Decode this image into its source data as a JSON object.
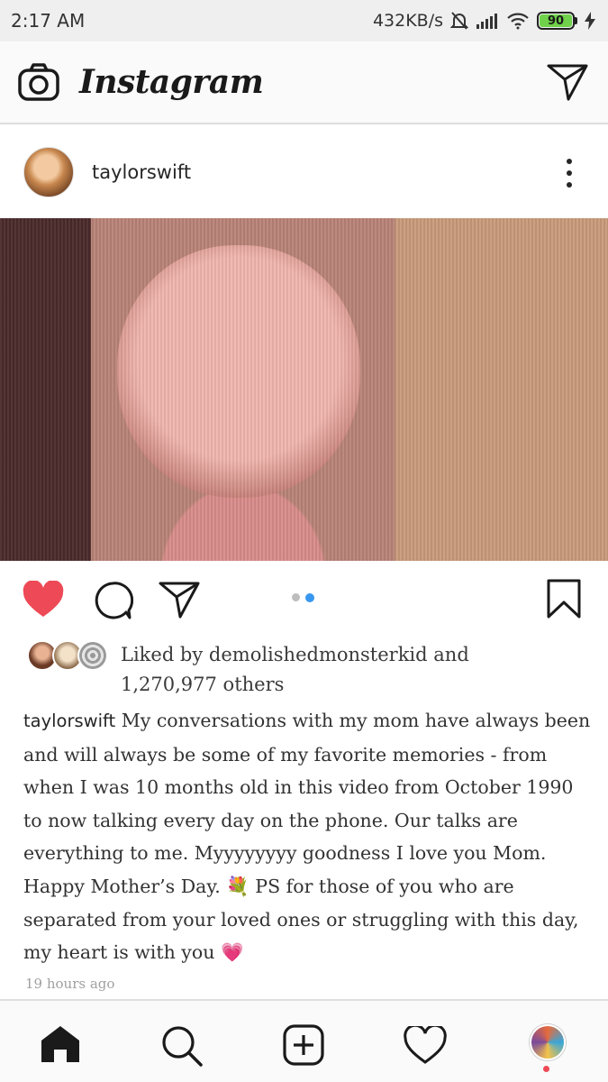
{
  "status_bar": {
    "time": "2:17 AM",
    "speed": "432KB/s",
    "battery": "90",
    "battery_color": "#6fd24a"
  },
  "app_bar": {
    "logo": "Instagram",
    "icons": [
      "camera-icon",
      "direct-message-icon"
    ]
  },
  "post": {
    "username": "taylorswift",
    "liked_by": "Liked by demolishedmonsterkid and 1,270,977 others",
    "caption_username": "taylorswift",
    "caption_text": "My conversations with my mom have always been and will always be some of my favorite memories - from when I was 10 months old in this video from October 1990 to now talking every day on the phone. Our talks are everything to me. Myyyyyyyy goodness I love you Mom. Happy Mother’s Day. 💐 PS for those of you who are separated from your loved ones or struggling with this day, my heart is with you 💗",
    "time_ago": "19 hours ago",
    "carousel": {
      "count": 2,
      "active_index": 1
    },
    "liked": true,
    "like_color": "#ed4956"
  },
  "bottom_nav": {
    "items": [
      "home-icon",
      "search-icon",
      "new-post-icon",
      "activity-icon",
      "profile-avatar"
    ]
  }
}
